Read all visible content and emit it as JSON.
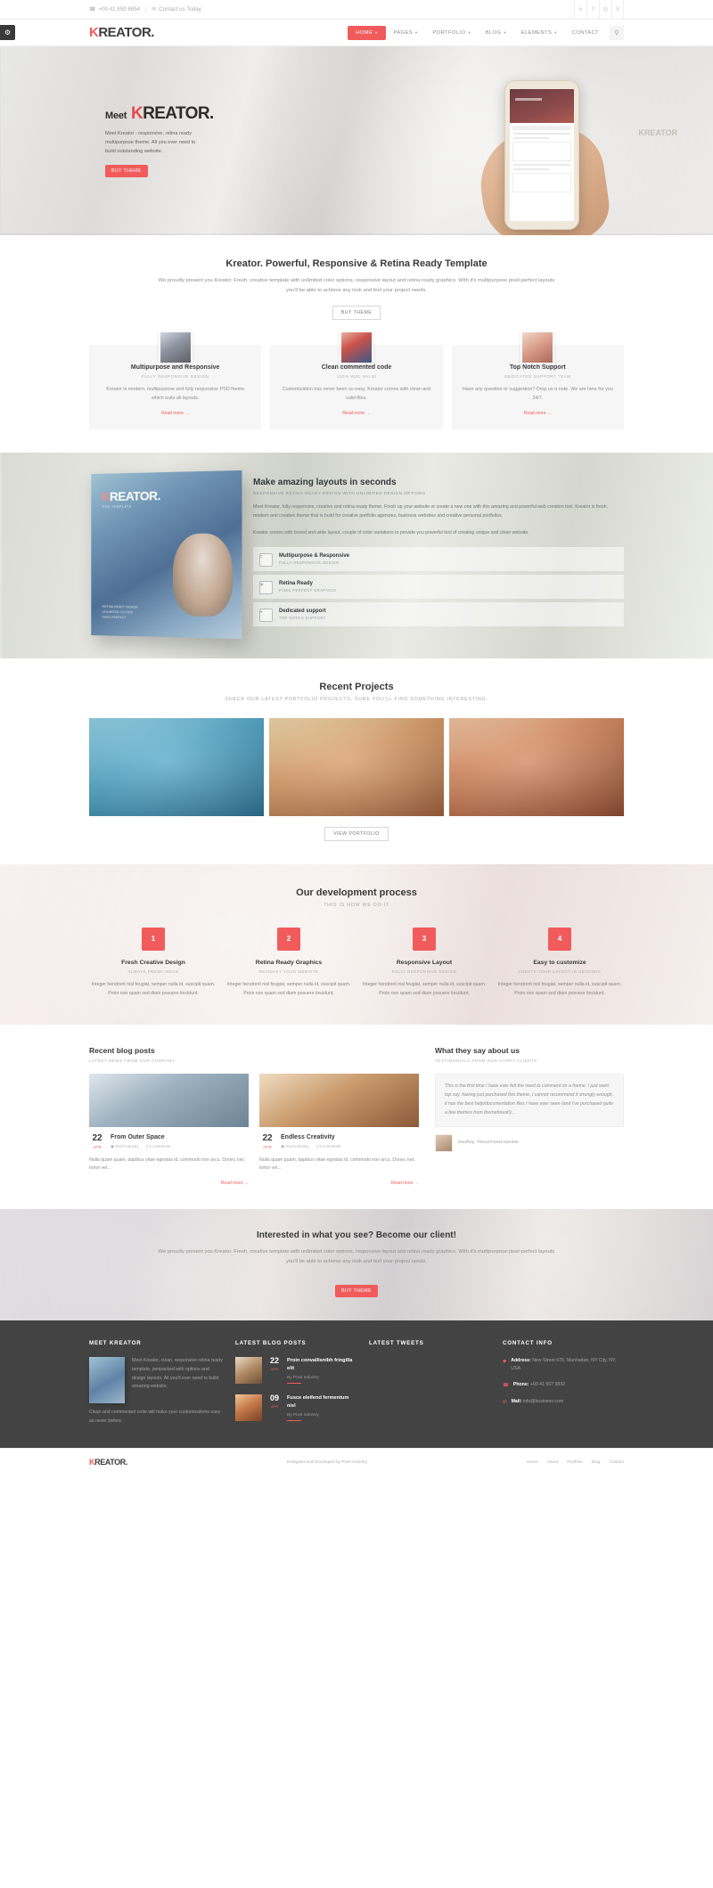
{
  "topbar": {
    "phone": "+00 41 859 6854",
    "contact": "Contact us Today",
    "socials": [
      "twitter-icon",
      "facebook-icon",
      "dribbble-icon",
      "vimeo-icon"
    ],
    "social_glyphs": [
      "ᴠ",
      "f",
      "◎",
      "V"
    ]
  },
  "header": {
    "logo_first": "K",
    "logo_rest": "REATOR.",
    "nav": [
      {
        "label": "HOME",
        "has_caret": true,
        "active": true
      },
      {
        "label": "PAGES",
        "has_caret": true,
        "active": false
      },
      {
        "label": "PORTFOLIO",
        "has_caret": true,
        "active": false
      },
      {
        "label": "BLOG",
        "has_caret": true,
        "active": false
      },
      {
        "label": "ELEMENTS",
        "has_caret": true,
        "active": false
      },
      {
        "label": "CONTACT",
        "has_caret": false,
        "active": false
      }
    ],
    "search_glyph": "⚲"
  },
  "settings_tab": {
    "glyph": "⚙"
  },
  "hero": {
    "meet": "Meet",
    "title_k": "K",
    "title_rest": "REATOR.",
    "paragraph": "Meet Kreator - responsive, retina ready multipurpose theme. All you ever need to build outstanding website.",
    "button": "BUY THEME",
    "watermark": "KREATOR"
  },
  "intro": {
    "title": "Kreator. Powerful, Responsive & Retina Ready Template",
    "paragraph": "We proudly present you Kreator. Fresh, creative template with unlimited color options, responsive layout and retina ready graphics. With it's multipurpose pixel-perfect layouts you'll be able to achieve any look and feel your project needs.",
    "button": "BUY THEME"
  },
  "features": [
    {
      "title": "Multipurpose and Responsive",
      "subtitle": "FULLY RESPONSIVE DESIGN",
      "text": "Kreator is modern, multipurpose and fully responsive PSD theme which suits all layouts.",
      "readmore": "Read more  →"
    },
    {
      "title": "Clean commented code",
      "subtitle": "100% W3C VALID",
      "text": "Customization has never been so easy. Kreator comes with clean and valid files.",
      "readmore": "Read more  →"
    },
    {
      "title": "Top Notch Support",
      "subtitle": "DEDICATED SUPPORT TEAM",
      "text": "Have any question or suggestion? Drop us a note. We are here for you 24/7.",
      "readmore": "Read more  →"
    }
  ],
  "layouts": {
    "box_logo_k": "K",
    "box_logo_rest": "REATOR.",
    "box_sub": "PSD TEMPLATE",
    "box_bottom": "RETINA READY DESIGN\nUNLIMITED COLORS\nPIXEL PERFECT",
    "title": "Make amazing layouts in seconds",
    "subtitle": "RESPONSIVE RETINA READY DESIGN WITH UNLIMITED DESIGN OPTIONS",
    "p1": "Meet Kreator, fully responsive, creative and retina ready theme. Fresh up your website or create a new one with this amazing and powerful web creation tool. Kreator is fresh, modern and creative theme that is build for creative portfolio agencies, business websites and creative personal portfolios.",
    "p2": "Kreator comes with boxed and wide layout, couple of color variations to provide you powerful tool of creating unique and clean website.",
    "items": [
      {
        "icon": "monitor-icon",
        "glyph": "⎕",
        "title": "Multipurpose & Responsive",
        "sub": "FULLY RESPONSIVE DESIGN"
      },
      {
        "icon": "eye-icon",
        "glyph": "◉",
        "title": "Retina Ready",
        "sub": "PIXEL PERFECT GRAPHICS"
      },
      {
        "icon": "heart-icon",
        "glyph": "♥",
        "title": "Dedicated support",
        "sub": "TOP NOTCH SUPPORT"
      }
    ]
  },
  "projects": {
    "title": "Recent Projects",
    "subtitle": "CHECK OUR LATEST PORTFOLIO PROJECTS, SURE YOU'LL FIND SOMETHING INTERESTING.",
    "button": "VIEW PORTFOLIO",
    "items": [
      "project-thumb-1",
      "project-thumb-2",
      "project-thumb-3"
    ]
  },
  "process": {
    "title": "Our development process",
    "subtitle": "THIS IS HOW WE DO IT",
    "steps": [
      {
        "num": "1",
        "title": "Fresh Creative Design",
        "sub": "ALWAYS FRESH IDEAS",
        "text": "Integer hendrerit nisl feugiat, semper nulla id, suscipit quam. Proin non quam sed diam posuere tincidunt."
      },
      {
        "num": "2",
        "title": "Retina Ready Graphics",
        "sub": "RETINAFY YOUR WEBSITE",
        "text": "Integer hendrerit nisl feugiat, semper nulla id, suscipit quam. Proin non quam sed diam posuere tincidunt."
      },
      {
        "num": "3",
        "title": "Responsive Layout",
        "sub": "FULLY RESPONSIVE DESIGN",
        "text": "Integer hendrerit nisl feugiat, semper nulla id, suscipit quam. Proin non quam sed diam posuere tincidunt."
      },
      {
        "num": "4",
        "title": "Easy to customize",
        "sub": "CREATE YOUR LAYOUT IN SECONDS",
        "text": "Integer hendrerit nisl feugiat, semper nulla id, suscipit quam. Proin non quam sed diam posuere tincidunt."
      }
    ]
  },
  "blog": {
    "title": "Recent blog posts",
    "subtitle": "LATEST NEWS FROM OUR COMPANY",
    "posts": [
      {
        "day": "22",
        "month": "APR",
        "title": "From Outer Space",
        "cat_icon": "image-icon",
        "cat": "Pixel Industry",
        "comment_icon": "comment-icon",
        "comments": "5 comments",
        "text": "Nulla quam quam, dapibus vitae egestas id, commodo non arcu. Donec nec tortor vel...",
        "readmore": "Read more  →"
      },
      {
        "day": "22",
        "month": "APR",
        "title": "Endless Creativity",
        "cat_icon": "image-icon",
        "cat": "Pixel Industry",
        "comment_icon": "comment-icon",
        "comments": "5 comments",
        "text": "Nulla quam quam, dapibus vitae egestas id, commodo non arcu. Donec nec tortor vel...",
        "readmore": "Read more  →"
      }
    ]
  },
  "testimonials": {
    "title": "What they say about us",
    "subtitle": "TESTIMONIALS FROM OUR HAPPY CLIENTS",
    "quote": "This is the first time I have ever felt the need to comment on a theme. I just want top say, having just purchased this theme, I cannot recommend it strongly enough, it has the best help/documentation files I have ever seen (and I've purchased quite a few themes from themeforest!)...",
    "author": "Geoffrey, ThemeForest member"
  },
  "cta": {
    "title": "Interested in what you see? Become our client!",
    "paragraph": "We proudly present you Kreator. Fresh, creative template with unlimited color options, responsive layout and retina ready graphics. With it's multipurpose pixel-perfect layouts you'll be able to achieve any look and feel your project needs.",
    "button": "BUY THEME"
  },
  "footer": {
    "col1": {
      "title": "MEET KREATOR",
      "text": "Meet Kreator, clean, responsive retina ready template, jampacked with options and design layouts. All you'll ever need to build amazing website.",
      "text2": "Clean and commented code will make your customizations easy as never before."
    },
    "col2": {
      "title": "LATEST BLOG POSTS",
      "posts": [
        {
          "day": "22",
          "month": "APR",
          "title": "Proin convallisnibh fringilla elit",
          "by": "By Pixel Industry"
        },
        {
          "day": "09",
          "month": "APR",
          "title": "Fusce eleifend fermentum nisl",
          "by": "By Pixel Industry"
        }
      ]
    },
    "col3": {
      "title": "LATEST TWEETS"
    },
    "col4": {
      "title": "CONTACT INFO",
      "items": [
        {
          "icon": "location-icon",
          "glyph": "◆",
          "label": "Address:",
          "value": "New Street 675, Manhattan, NY City, NY, USA"
        },
        {
          "icon": "phone-icon",
          "glyph": "☎",
          "label": "Phone:",
          "value": "+00 41 567 9832"
        },
        {
          "icon": "mail-icon",
          "glyph": "✉",
          "label": "Mail:",
          "value": "info@business.com"
        }
      ]
    }
  },
  "subfooter": {
    "logo_k": "K",
    "logo_rest": "REATOR.",
    "credit": "Designed and Developed by Pixel Industry",
    "nav": [
      "Home",
      "About",
      "Portfolio",
      "Blog",
      "Contact"
    ]
  }
}
